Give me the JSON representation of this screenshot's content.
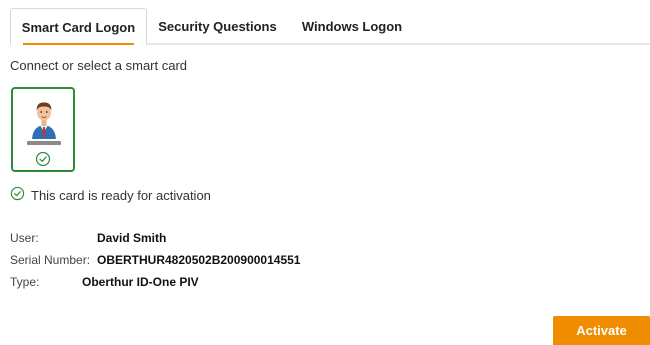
{
  "tabs": [
    {
      "label": "Smart Card Logon",
      "active": true
    },
    {
      "label": "Security Questions",
      "active": false
    },
    {
      "label": "Windows Logon",
      "active": false
    }
  ],
  "prompt": "Connect or select a smart card",
  "card": {
    "avatar_icon": "user-avatar-icon",
    "check_icon": "check-circle-icon",
    "accent": "#2e8b3c"
  },
  "status": {
    "icon": "check-circle-icon",
    "text": "This card is ready for activation"
  },
  "info": {
    "user_label": "User:",
    "user_value": "David Smith",
    "serial_label": "Serial Number:",
    "serial_value": "OBERTHUR4820502B200900014551",
    "type_label": "Type:",
    "type_value": "Oberthur ID-One PIV"
  },
  "activate_label": "Activate",
  "colors": {
    "accent": "#f08c00",
    "success": "#2e8b3c"
  }
}
